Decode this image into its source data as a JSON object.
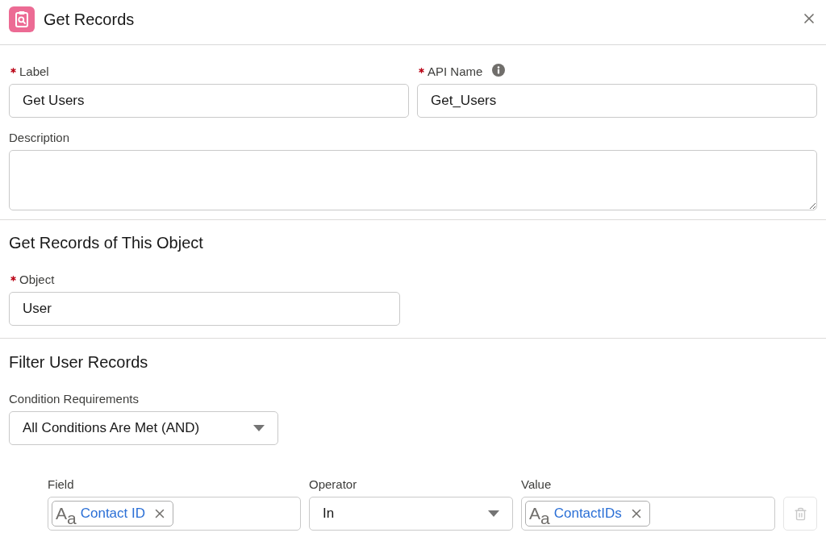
{
  "dialog": {
    "title": "Get Records"
  },
  "name_fields": [
    {
      "label": "Label",
      "required": true,
      "info": false,
      "value": "Get Users"
    },
    {
      "label": "API Name",
      "required": true,
      "info": true,
      "value": "Get_Users"
    }
  ],
  "description": {
    "label": "Description"
  },
  "object_section": {
    "title": "Get Records of This Object",
    "object_field": {
      "label": "Object",
      "required": true,
      "value": "User"
    }
  },
  "filter_section": {
    "title": "Filter User Records",
    "condition_requirements": {
      "label": "Condition Requirements",
      "value": "All Conditions Are Met (AND)"
    },
    "conditions": [
      {
        "field": {
          "label": "Field",
          "type_glyph": "A$_{a}$",
          "value": "Contact ID"
        },
        "operator": {
          "label": "Operator",
          "value": "In"
        },
        "value": {
          "label": "Value",
          "type_glyph": "A$_{a}$",
          "value": "ContactIDs"
        },
        "delete_disabled": true
      }
    ]
  }
}
